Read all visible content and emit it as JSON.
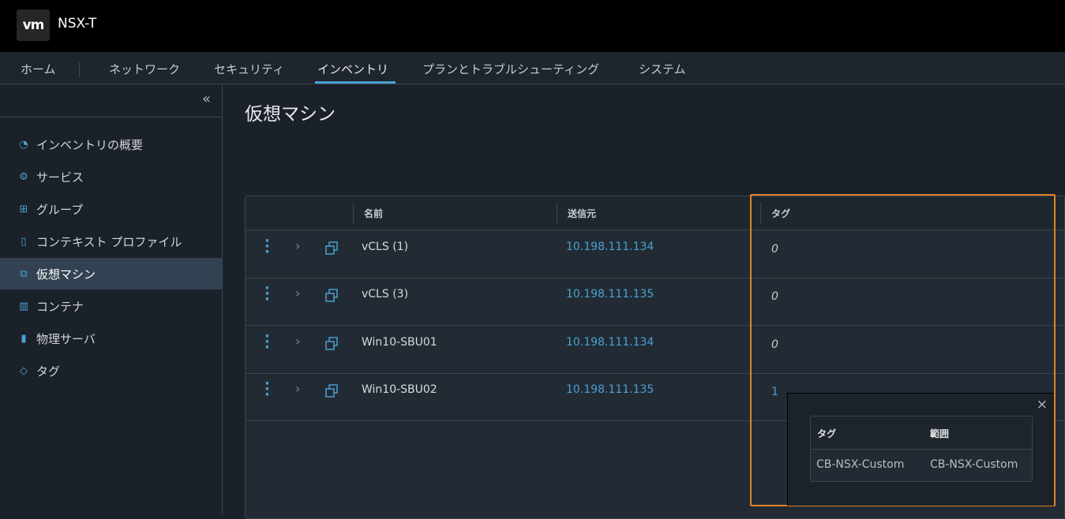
{
  "header": {
    "logo": "vm",
    "app_title": "NSX-T"
  },
  "nav": {
    "tabs": [
      "ホーム",
      "ネットワーク",
      "セキュリティ",
      "インベントリ",
      "プランとトラブルシューティング",
      "システム"
    ],
    "active": "インベントリ"
  },
  "sidebar": {
    "collapse": "«",
    "items": [
      {
        "label": "インベントリの概要",
        "icon": "dashboard-icon"
      },
      {
        "label": "サービス",
        "icon": "gear-icon"
      },
      {
        "label": "グループ",
        "icon": "group-icon"
      },
      {
        "label": "コンテキスト プロファイル",
        "icon": "profile-icon"
      },
      {
        "label": "仮想マシン",
        "icon": "vm-icon",
        "active": true
      },
      {
        "label": "コンテナ",
        "icon": "container-icon"
      },
      {
        "label": "物理サーバ",
        "icon": "server-icon"
      },
      {
        "label": "タグ",
        "icon": "tag-icon"
      }
    ]
  },
  "main": {
    "title": "仮想マシン",
    "table": {
      "columns": [
        "名前",
        "送信元",
        "タグ"
      ],
      "rows": [
        {
          "name": "vCLS (1)",
          "source": "10.198.111.134",
          "tags": "0"
        },
        {
          "name": "vCLS (3)",
          "source": "10.198.111.135",
          "tags": "0"
        },
        {
          "name": "Win10-SBU01",
          "source": "10.198.111.134",
          "tags": "0"
        },
        {
          "name": "Win10-SBU02",
          "source": "10.198.111.135",
          "tags": "1"
        }
      ]
    }
  },
  "popover": {
    "close": "×",
    "columns": [
      "タグ",
      "範囲"
    ],
    "rows": [
      {
        "tag": "CB-NSX-Custom",
        "scope": "CB-NSX-Custom"
      }
    ]
  },
  "colors": {
    "accent": "#4aa0d5",
    "highlight": "#e0812a"
  }
}
